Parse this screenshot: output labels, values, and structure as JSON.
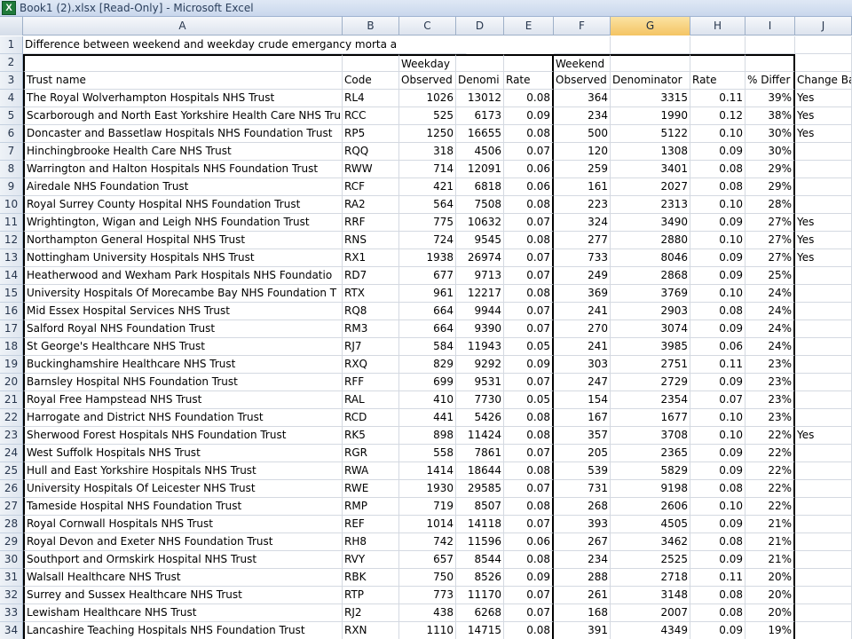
{
  "window": {
    "title": "Book1 (2).xlsx  [Read-Only] - Microsoft Excel",
    "app_icon": "excel-icon"
  },
  "columns": [
    "A",
    "B",
    "C",
    "D",
    "E",
    "F",
    "G",
    "H",
    "I",
    "J"
  ],
  "selected_column": "G",
  "row1": "Difference between weekend and weekday crude emergancy morta a",
  "row2": {
    "weekday": "Weekday",
    "weekend": "Weekend"
  },
  "row3": [
    "Trust name",
    "Code",
    "Observed",
    "Denomi",
    "Rate",
    "Observed",
    "Denominator",
    "Rate",
    "% Differ",
    "Change Ba"
  ],
  "rows": [
    {
      "n": "4",
      "name": "The Royal Wolverhampton Hospitals NHS Trust",
      "code": "RL4",
      "c": "1026",
      "d": "13012",
      "e": "0.08",
      "f": "364",
      "g": "3315",
      "h": "0.11",
      "i": "39%",
      "j": "Yes"
    },
    {
      "n": "5",
      "name": "Scarborough and North East Yorkshire Health Care NHS Tru",
      "code": "RCC",
      "c": "525",
      "d": "6173",
      "e": "0.09",
      "f": "234",
      "g": "1990",
      "h": "0.12",
      "i": "38%",
      "j": "Yes"
    },
    {
      "n": "6",
      "name": "Doncaster and Bassetlaw Hospitals NHS Foundation Trust",
      "code": "RP5",
      "c": "1250",
      "d": "16655",
      "e": "0.08",
      "f": "500",
      "g": "5122",
      "h": "0.10",
      "i": "30%",
      "j": "Yes"
    },
    {
      "n": "7",
      "name": "Hinchingbrooke Health Care NHS Trust",
      "code": "RQQ",
      "c": "318",
      "d": "4506",
      "e": "0.07",
      "f": "120",
      "g": "1308",
      "h": "0.09",
      "i": "30%",
      "j": ""
    },
    {
      "n": "8",
      "name": "Warrington and Halton Hospitals NHS Foundation Trust",
      "code": "RWW",
      "c": "714",
      "d": "12091",
      "e": "0.06",
      "f": "259",
      "g": "3401",
      "h": "0.08",
      "i": "29%",
      "j": ""
    },
    {
      "n": "9",
      "name": "Airedale NHS Foundation Trust",
      "code": "RCF",
      "c": "421",
      "d": "6818",
      "e": "0.06",
      "f": "161",
      "g": "2027",
      "h": "0.08",
      "i": "29%",
      "j": ""
    },
    {
      "n": "10",
      "name": "Royal Surrey County Hospital NHS Foundation Trust",
      "code": "RA2",
      "c": "564",
      "d": "7508",
      "e": "0.08",
      "f": "223",
      "g": "2313",
      "h": "0.10",
      "i": "28%",
      "j": ""
    },
    {
      "n": "11",
      "name": "Wrightington, Wigan and Leigh NHS Foundation Trust",
      "code": "RRF",
      "c": "775",
      "d": "10632",
      "e": "0.07",
      "f": "324",
      "g": "3490",
      "h": "0.09",
      "i": "27%",
      "j": "Yes"
    },
    {
      "n": "12",
      "name": "Northampton General Hospital NHS Trust",
      "code": "RNS",
      "c": "724",
      "d": "9545",
      "e": "0.08",
      "f": "277",
      "g": "2880",
      "h": "0.10",
      "i": "27%",
      "j": "Yes"
    },
    {
      "n": "13",
      "name": "Nottingham University Hospitals NHS Trust",
      "code": "RX1",
      "c": "1938",
      "d": "26974",
      "e": "0.07",
      "f": "733",
      "g": "8046",
      "h": "0.09",
      "i": "27%",
      "j": "Yes"
    },
    {
      "n": "14",
      "name": "Heatherwood and Wexham Park Hospitals NHS Foundatio",
      "code": "RD7",
      "c": "677",
      "d": "9713",
      "e": "0.07",
      "f": "249",
      "g": "2868",
      "h": "0.09",
      "i": "25%",
      "j": ""
    },
    {
      "n": "15",
      "name": "University Hospitals Of Morecambe Bay NHS Foundation T",
      "code": "RTX",
      "c": "961",
      "d": "12217",
      "e": "0.08",
      "f": "369",
      "g": "3769",
      "h": "0.10",
      "i": "24%",
      "j": ""
    },
    {
      "n": "16",
      "name": "Mid Essex Hospital Services NHS Trust",
      "code": "RQ8",
      "c": "664",
      "d": "9944",
      "e": "0.07",
      "f": "241",
      "g": "2903",
      "h": "0.08",
      "i": "24%",
      "j": ""
    },
    {
      "n": "17",
      "name": "Salford Royal NHS Foundation Trust",
      "code": "RM3",
      "c": "664",
      "d": "9390",
      "e": "0.07",
      "f": "270",
      "g": "3074",
      "h": "0.09",
      "i": "24%",
      "j": ""
    },
    {
      "n": "18",
      "name": "St George's Healthcare NHS Trust",
      "code": "RJ7",
      "c": "584",
      "d": "11943",
      "e": "0.05",
      "f": "241",
      "g": "3985",
      "h": "0.06",
      "i": "24%",
      "j": ""
    },
    {
      "n": "19",
      "name": "Buckinghamshire Healthcare NHS Trust",
      "code": "RXQ",
      "c": "829",
      "d": "9292",
      "e": "0.09",
      "f": "303",
      "g": "2751",
      "h": "0.11",
      "i": "23%",
      "j": ""
    },
    {
      "n": "20",
      "name": "Barnsley Hospital NHS Foundation Trust",
      "code": "RFF",
      "c": "699",
      "d": "9531",
      "e": "0.07",
      "f": "247",
      "g": "2729",
      "h": "0.09",
      "i": "23%",
      "j": ""
    },
    {
      "n": "21",
      "name": "Royal Free Hampstead NHS Trust",
      "code": "RAL",
      "c": "410",
      "d": "7730",
      "e": "0.05",
      "f": "154",
      "g": "2354",
      "h": "0.07",
      "i": "23%",
      "j": ""
    },
    {
      "n": "22",
      "name": "Harrogate and District NHS Foundation Trust",
      "code": "RCD",
      "c": "441",
      "d": "5426",
      "e": "0.08",
      "f": "167",
      "g": "1677",
      "h": "0.10",
      "i": "23%",
      "j": ""
    },
    {
      "n": "23",
      "name": "Sherwood Forest Hospitals NHS Foundation Trust",
      "code": "RK5",
      "c": "898",
      "d": "11424",
      "e": "0.08",
      "f": "357",
      "g": "3708",
      "h": "0.10",
      "i": "22%",
      "j": "Yes"
    },
    {
      "n": "24",
      "name": "West Suffolk Hospitals NHS Trust",
      "code": "RGR",
      "c": "558",
      "d": "7861",
      "e": "0.07",
      "f": "205",
      "g": "2365",
      "h": "0.09",
      "i": "22%",
      "j": ""
    },
    {
      "n": "25",
      "name": "Hull and East Yorkshire Hospitals NHS Trust",
      "code": "RWA",
      "c": "1414",
      "d": "18644",
      "e": "0.08",
      "f": "539",
      "g": "5829",
      "h": "0.09",
      "i": "22%",
      "j": ""
    },
    {
      "n": "26",
      "name": "University Hospitals Of Leicester NHS Trust",
      "code": "RWE",
      "c": "1930",
      "d": "29585",
      "e": "0.07",
      "f": "731",
      "g": "9198",
      "h": "0.08",
      "i": "22%",
      "j": ""
    },
    {
      "n": "27",
      "name": "Tameside Hospital NHS Foundation Trust",
      "code": "RMP",
      "c": "719",
      "d": "8507",
      "e": "0.08",
      "f": "268",
      "g": "2606",
      "h": "0.10",
      "i": "22%",
      "j": ""
    },
    {
      "n": "28",
      "name": "Royal Cornwall Hospitals NHS Trust",
      "code": "REF",
      "c": "1014",
      "d": "14118",
      "e": "0.07",
      "f": "393",
      "g": "4505",
      "h": "0.09",
      "i": "21%",
      "j": ""
    },
    {
      "n": "29",
      "name": "Royal Devon and Exeter NHS Foundation Trust",
      "code": "RH8",
      "c": "742",
      "d": "11596",
      "e": "0.06",
      "f": "267",
      "g": "3462",
      "h": "0.08",
      "i": "21%",
      "j": ""
    },
    {
      "n": "30",
      "name": "Southport and Ormskirk Hospital NHS Trust",
      "code": "RVY",
      "c": "657",
      "d": "8544",
      "e": "0.08",
      "f": "234",
      "g": "2525",
      "h": "0.09",
      "i": "21%",
      "j": ""
    },
    {
      "n": "31",
      "name": "Walsall Healthcare NHS Trust",
      "code": "RBK",
      "c": "750",
      "d": "8526",
      "e": "0.09",
      "f": "288",
      "g": "2718",
      "h": "0.11",
      "i": "20%",
      "j": ""
    },
    {
      "n": "32",
      "name": "Surrey and Sussex Healthcare NHS Trust",
      "code": "RTP",
      "c": "773",
      "d": "11170",
      "e": "0.07",
      "f": "261",
      "g": "3148",
      "h": "0.08",
      "i": "20%",
      "j": ""
    },
    {
      "n": "33",
      "name": "Lewisham Healthcare NHS Trust",
      "code": "RJ2",
      "c": "438",
      "d": "6268",
      "e": "0.07",
      "f": "168",
      "g": "2007",
      "h": "0.08",
      "i": "20%",
      "j": ""
    },
    {
      "n": "34",
      "name": "Lancashire Teaching Hospitals NHS Foundation Trust",
      "code": "RXN",
      "c": "1110",
      "d": "14715",
      "e": "0.08",
      "f": "391",
      "g": "4349",
      "h": "0.09",
      "i": "19%",
      "j": ""
    }
  ]
}
